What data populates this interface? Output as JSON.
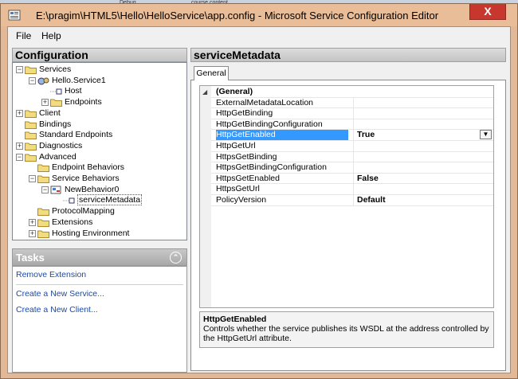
{
  "taskbar": {
    "item1": "Debug",
    "item2": "course content"
  },
  "window": {
    "title": "E:\\pragim\\HTML5\\Hello\\HelloService\\app.config - Microsoft Service Configuration Editor",
    "close": "X"
  },
  "menu": {
    "file": "File",
    "help": "Help"
  },
  "configuration": {
    "title": "Configuration",
    "tree": [
      {
        "label": "Services",
        "level": 0,
        "exp": "-"
      },
      {
        "label": "Hello.Service1",
        "level": 1,
        "exp": "-"
      },
      {
        "label": "Host",
        "level": 2,
        "exp": ""
      },
      {
        "label": "Endpoints",
        "level": 2,
        "exp": "+"
      },
      {
        "label": "Client",
        "level": 0,
        "exp": "+"
      },
      {
        "label": "Bindings",
        "level": 0,
        "exp": ""
      },
      {
        "label": "Standard Endpoints",
        "level": 0,
        "exp": ""
      },
      {
        "label": "Diagnostics",
        "level": 0,
        "exp": "+"
      },
      {
        "label": "Advanced",
        "level": 0,
        "exp": "-"
      },
      {
        "label": "Endpoint Behaviors",
        "level": 1,
        "exp": ""
      },
      {
        "label": "Service Behaviors",
        "level": 1,
        "exp": "-"
      },
      {
        "label": "NewBehavior0",
        "level": 2,
        "exp": "-"
      },
      {
        "label": "serviceMetadata",
        "level": 3,
        "exp": ""
      },
      {
        "label": "ProtocolMapping",
        "level": 1,
        "exp": ""
      },
      {
        "label": "Extensions",
        "level": 1,
        "exp": "+"
      },
      {
        "label": "Hosting Environment",
        "level": 1,
        "exp": "+"
      }
    ]
  },
  "tasks": {
    "title": "Tasks",
    "links": [
      "Remove Extension",
      "Create a New Service...",
      "Create a New Client..."
    ]
  },
  "detail": {
    "title": "serviceMetadata",
    "tab": "General",
    "category": "(General)",
    "properties": [
      {
        "name": "ExternalMetadataLocation",
        "value": ""
      },
      {
        "name": "HttpGetBinding",
        "value": ""
      },
      {
        "name": "HttpGetBindingConfiguration",
        "value": ""
      },
      {
        "name": "HttpGetEnabled",
        "value": "True"
      },
      {
        "name": "HttpGetUrl",
        "value": ""
      },
      {
        "name": "HttpsGetBinding",
        "value": ""
      },
      {
        "name": "HttpsGetBindingConfiguration",
        "value": ""
      },
      {
        "name": "HttpsGetEnabled",
        "value": "False"
      },
      {
        "name": "HttpsGetUrl",
        "value": ""
      },
      {
        "name": "PolicyVersion",
        "value": "Default"
      }
    ],
    "description": {
      "title": "HttpGetEnabled",
      "text": "Controls whether the service publishes its WSDL at the address controlled by the HttpGetUrl attribute."
    }
  },
  "colors": {
    "selection": "#3399ff",
    "link": "#1a4aa8",
    "frame": "#e3b896",
    "close": "#c7372e"
  }
}
